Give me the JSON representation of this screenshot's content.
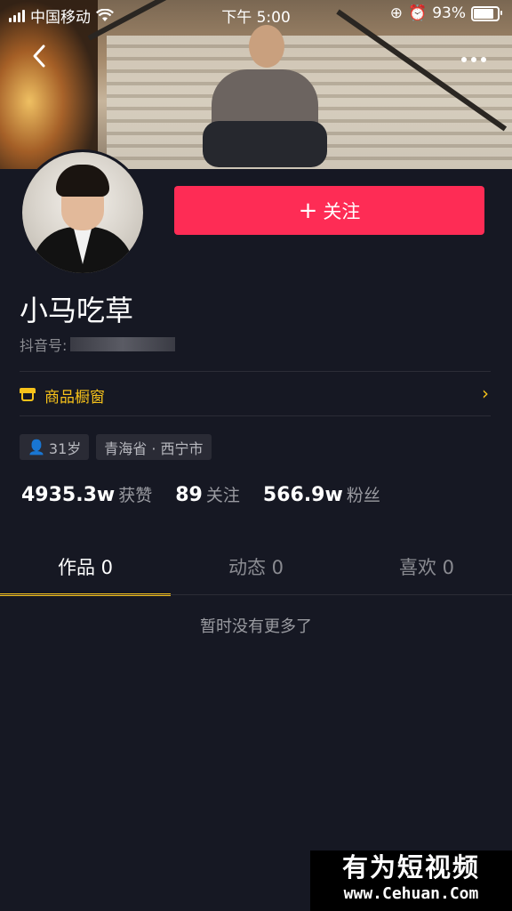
{
  "status_bar": {
    "carrier": "中国移动",
    "time": "下午 5:00",
    "battery": "93%",
    "battery_level": 0.93
  },
  "profile": {
    "name": "小马吃草",
    "id_label": "抖音号:",
    "follow_button": "关注"
  },
  "shop": {
    "label": "商品橱窗"
  },
  "tags": {
    "age": "31岁",
    "location": "青海省 · 西宁市"
  },
  "stats": {
    "likes_value": "4935.3w",
    "likes_label": "获赞",
    "following_value": "89",
    "following_label": "关注",
    "fans_value": "566.9w",
    "fans_label": "粉丝"
  },
  "tabs": [
    {
      "label": "作品 0"
    },
    {
      "label": "动态 0"
    },
    {
      "label": "喜欢 0"
    }
  ],
  "empty_message": "暂时没有更多了",
  "watermark": {
    "title": "有为短视频",
    "url": "www.Cehuan.Com"
  },
  "colors": {
    "background": "#161823",
    "accent_red": "#fe2c55",
    "accent_yellow": "#f7c21a"
  }
}
